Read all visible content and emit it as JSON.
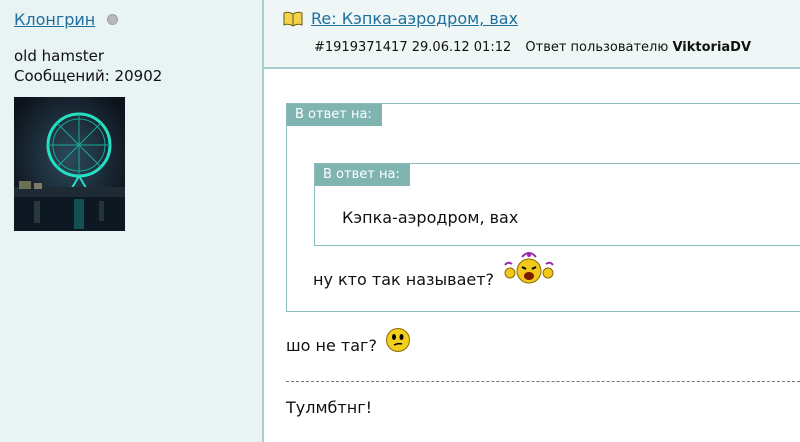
{
  "author": {
    "name": "Клонгрин",
    "title": "old hamster",
    "post_count": "Сообщений: 20902",
    "status_icon": "offline-status-dot"
  },
  "post": {
    "title": "Re: Кэпка-аэродром, вах",
    "id": "#1919371417",
    "date": "29.06.12 01:12",
    "reply_prefix": "Ответ пользователю",
    "reply_user": "ViktoriaDV",
    "title_icon": "book-icon"
  },
  "quotes": {
    "outer_label": "В ответ на:",
    "inner_label": "В ответ на:",
    "inner_text": "Кэпка-аэродром, вах",
    "outer_text": "ну кто так называет?",
    "outer_emoji": "crying-emoji"
  },
  "body": {
    "reply_text": "шо не таг?",
    "reply_emoji": "thinking-smile-emoji",
    "signature": "Тулмбтнг!"
  },
  "colors": {
    "sidebar_bg": "#e8f3f3",
    "header_bg": "#eef6f6",
    "border": "#a9cdcd",
    "link": "#1e6f9b",
    "quote_label_bg": "#7fb4b0"
  }
}
